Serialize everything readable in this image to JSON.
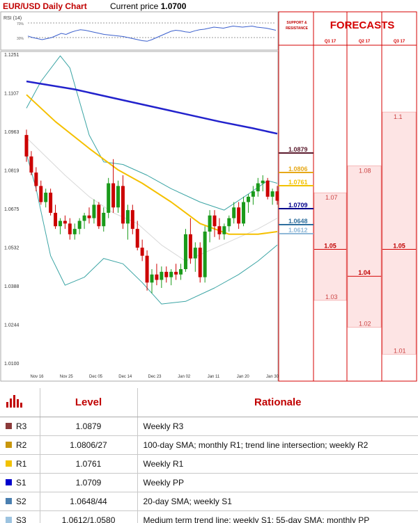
{
  "header": {
    "title": "EUR/USD Daily Chart",
    "price_label": "Current price",
    "price_value": "1.0700"
  },
  "rsi_label": "RSI (14)",
  "sr_label": "SUPPORT & RESISTANCE",
  "forecast_title": "FORECASTS",
  "chart_data": {
    "type": "candlestick",
    "y_ticks": [
      "1.1251",
      "1.1107",
      "1.0963",
      "1.0819",
      "1.0675",
      "1.0532",
      "1.0388",
      "1.0244",
      "1.0100"
    ],
    "y_range": [
      1.01,
      1.1251
    ],
    "x_ticks": [
      "Nov 16",
      "Nov 25",
      "Dec 05",
      "Dec 14",
      "Dec 23",
      "Jan 02",
      "Jan 11",
      "Jan 20",
      "Jan 30"
    ],
    "candles": [
      [
        1.095,
        1.097,
        1.085,
        1.087
      ],
      [
        1.087,
        1.089,
        1.08,
        1.081
      ],
      [
        1.081,
        1.083,
        1.074,
        1.076
      ],
      [
        1.076,
        1.078,
        1.069,
        1.07
      ],
      [
        1.07,
        1.075,
        1.068,
        1.0735
      ],
      [
        1.0735,
        1.075,
        1.065,
        1.066
      ],
      [
        1.066,
        1.069,
        1.06,
        1.061
      ],
      [
        1.061,
        1.064,
        1.058,
        1.063
      ],
      [
        1.063,
        1.065,
        1.06,
        1.062
      ],
      [
        1.062,
        1.064,
        1.056,
        1.058
      ],
      [
        1.058,
        1.062,
        1.056,
        1.06
      ],
      [
        1.06,
        1.064,
        1.058,
        1.063
      ],
      [
        1.063,
        1.066,
        1.06,
        1.065
      ],
      [
        1.065,
        1.068,
        1.062,
        1.064
      ],
      [
        1.064,
        1.071,
        1.062,
        1.069
      ],
      [
        1.069,
        1.07,
        1.06,
        1.061
      ],
      [
        1.061,
        1.068,
        1.059,
        1.066
      ],
      [
        1.066,
        1.079,
        1.064,
        1.077
      ],
      [
        1.077,
        1.086,
        1.066,
        1.068
      ],
      [
        1.068,
        1.078,
        1.066,
        1.076
      ],
      [
        1.076,
        1.08,
        1.06,
        1.062
      ],
      [
        1.062,
        1.069,
        1.056,
        1.067
      ],
      [
        1.067,
        1.069,
        1.058,
        1.06
      ],
      [
        1.06,
        1.063,
        1.052,
        1.053
      ],
      [
        1.053,
        1.056,
        1.048,
        1.05
      ],
      [
        1.05,
        1.052,
        1.037,
        1.04
      ],
      [
        1.04,
        1.045,
        1.036,
        1.043
      ],
      [
        1.043,
        1.047,
        1.039,
        1.041
      ],
      [
        1.041,
        1.046,
        1.038,
        1.044
      ],
      [
        1.044,
        1.046,
        1.04,
        1.042
      ],
      [
        1.042,
        1.045,
        1.039,
        1.044
      ],
      [
        1.044,
        1.047,
        1.041,
        1.043
      ],
      [
        1.043,
        1.047,
        1.041,
        1.045
      ],
      [
        1.045,
        1.06,
        1.044,
        1.058
      ],
      [
        1.058,
        1.064,
        1.047,
        1.049
      ],
      [
        1.049,
        1.055,
        1.044,
        1.053
      ],
      [
        1.053,
        1.055,
        1.04,
        1.042
      ],
      [
        1.042,
        1.061,
        1.04,
        1.059
      ],
      [
        1.059,
        1.067,
        1.055,
        1.065
      ],
      [
        1.065,
        1.067,
        1.057,
        1.061
      ],
      [
        1.061,
        1.064,
        1.056,
        1.058
      ],
      [
        1.058,
        1.062,
        1.056,
        1.061
      ],
      [
        1.061,
        1.065,
        1.059,
        1.064
      ],
      [
        1.064,
        1.07,
        1.062,
        1.068
      ],
      [
        1.068,
        1.07,
        1.06,
        1.062
      ],
      [
        1.062,
        1.072,
        1.061,
        1.07
      ],
      [
        1.07,
        1.073,
        1.066,
        1.072
      ],
      [
        1.072,
        1.076,
        1.069,
        1.074
      ],
      [
        1.074,
        1.079,
        1.072,
        1.077
      ],
      [
        1.077,
        1.08,
        1.074,
        1.078
      ],
      [
        1.078,
        1.079,
        1.071,
        1.072
      ],
      [
        1.072,
        1.075,
        1.069,
        1.074
      ],
      [
        1.074,
        1.076,
        1.069,
        1.0705
      ]
    ],
    "ma_200": [
      [
        0,
        1.115
      ],
      [
        10,
        1.112
      ],
      [
        20,
        1.108
      ],
      [
        30,
        1.104
      ],
      [
        40,
        1.1
      ],
      [
        47,
        1.0975
      ],
      [
        52,
        1.0955
      ]
    ],
    "ma_55": [
      [
        0,
        1.11
      ],
      [
        6,
        1.1
      ],
      [
        13,
        1.09
      ],
      [
        19,
        1.082
      ],
      [
        24,
        1.077
      ],
      [
        30,
        1.07
      ],
      [
        36,
        1.062
      ],
      [
        42,
        1.058
      ],
      [
        48,
        1.058
      ],
      [
        52,
        1.059
      ]
    ],
    "bb_upper": [
      [
        0,
        1.105
      ],
      [
        3,
        1.115
      ],
      [
        7,
        1.1245
      ],
      [
        9,
        1.12
      ],
      [
        13,
        1.095
      ],
      [
        16,
        1.085
      ],
      [
        20,
        1.084
      ],
      [
        25,
        1.08
      ],
      [
        30,
        1.075
      ],
      [
        36,
        1.07
      ],
      [
        41,
        1.067
      ],
      [
        46,
        1.073
      ],
      [
        50,
        1.078
      ],
      [
        52,
        1.077
      ]
    ],
    "bb_lower": [
      [
        0,
        1.088
      ],
      [
        2,
        1.075
      ],
      [
        5,
        1.05
      ],
      [
        8,
        1.039
      ],
      [
        12,
        1.042
      ],
      [
        16,
        1.049
      ],
      [
        20,
        1.047
      ],
      [
        24,
        1.04
      ],
      [
        28,
        1.032
      ],
      [
        33,
        1.033
      ],
      [
        39,
        1.038
      ],
      [
        44,
        1.043
      ],
      [
        48,
        1.048
      ],
      [
        52,
        1.054
      ]
    ],
    "bb_mid": [
      [
        0,
        1.094
      ],
      [
        4,
        1.087
      ],
      [
        8,
        1.08
      ],
      [
        13,
        1.072
      ],
      [
        18,
        1.066
      ],
      [
        23,
        1.062
      ],
      [
        28,
        1.054
      ],
      [
        33,
        1.048
      ],
      [
        38,
        1.052
      ],
      [
        43,
        1.056
      ],
      [
        48,
        1.06
      ],
      [
        52,
        1.064
      ]
    ],
    "rsi_levels": [
      "70%",
      "30%"
    ],
    "rsi_values": [
      45,
      42,
      40,
      38,
      40,
      42,
      46,
      50,
      48,
      52,
      55,
      57,
      56,
      54,
      52,
      50,
      48,
      47,
      46,
      45,
      44,
      42,
      40,
      38,
      36,
      35,
      38,
      42,
      46,
      50,
      54,
      56,
      55,
      53,
      52,
      55,
      57,
      58,
      60,
      62,
      61,
      60,
      62,
      64,
      63,
      62,
      63,
      64,
      62,
      61,
      60,
      58,
      56
    ]
  },
  "sr_levels": [
    {
      "value": "1.0879",
      "color": "#5a1a2c",
      "price": 1.0879
    },
    {
      "value": "1.0806",
      "color": "#e6a817",
      "price": 1.0806
    },
    {
      "value": "1.0761",
      "color": "#f2c200",
      "price": 1.0761
    },
    {
      "value": "1.0709",
      "color": "#00008b",
      "price": 1.0709
    },
    {
      "value": "1.0648",
      "color": "#2e6f9e",
      "price": 1.0648
    },
    {
      "value": "1.0612",
      "color": "#8fb8d8",
      "price": 1.0612
    }
  ],
  "forecast_columns": [
    {
      "label": "Q1 17",
      "high": "1.07",
      "mid": "1.05",
      "low": "1.03",
      "high_v": 1.07,
      "mid_v": 1.05,
      "low_v": 1.03
    },
    {
      "label": "Q2 17",
      "high": "1.08",
      "mid": "1.04",
      "low": "1.02",
      "high_v": 1.08,
      "mid_v": 1.04,
      "low_v": 1.02
    },
    {
      "label": "Q3 17",
      "high": "1.1",
      "mid": "1.05",
      "low": "1.01",
      "high_v": 1.1,
      "mid_v": 1.05,
      "low_v": 1.01
    }
  ],
  "levels_table": {
    "headers": {
      "level": "Level",
      "rationale": "Rationale"
    },
    "rows": [
      {
        "name": "R3",
        "value": "1.0879",
        "rationale": "Weekly R3",
        "color": "#8b3a3a"
      },
      {
        "name": "R2",
        "value": "1.0806/27",
        "rationale": "100-day SMA; monthly R1; trend line intersection; weekly R2",
        "color": "#c8960c"
      },
      {
        "name": "R1",
        "value": "1.0761",
        "rationale": "Weekly R1",
        "color": "#f2c200"
      },
      {
        "name": "S1",
        "value": "1.0709",
        "rationale": "Weekly PP",
        "color": "#0000cd"
      },
      {
        "name": "S2",
        "value": "1.0648/44",
        "rationale": "20-day SMA; weekly S1",
        "color": "#4a7fb0"
      },
      {
        "name": "S3",
        "value": "1.0612/1.0580",
        "rationale": "Medium term trend line; weekly S1; 55-day SMA; monthly PP",
        "color": "#9cc3e0"
      }
    ]
  }
}
